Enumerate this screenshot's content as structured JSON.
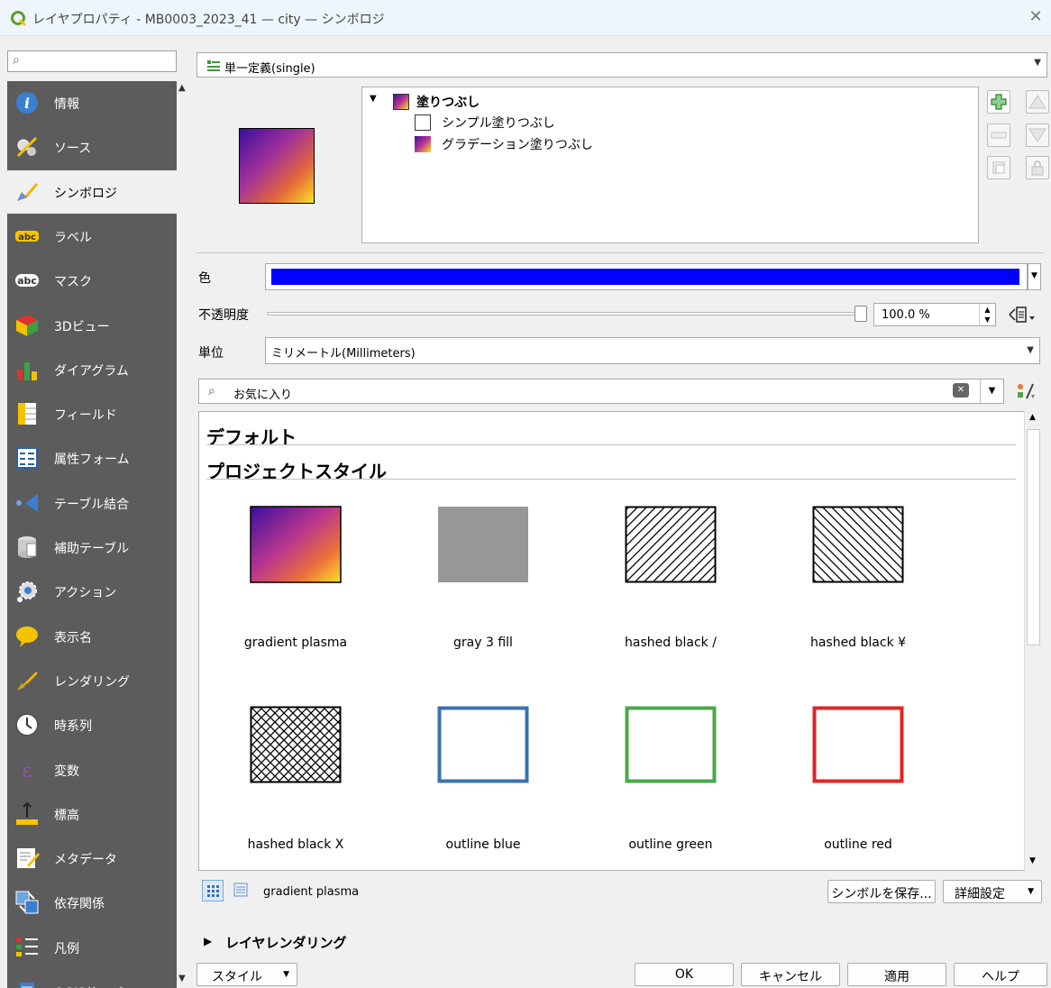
{
  "window": {
    "title": "レイヤプロパティ - MB0003_2023_41 — city — シンボロジ",
    "close_glyph": "✕"
  },
  "sidebar": {
    "search_placeholder": "",
    "items": [
      {
        "label": "情報",
        "icon": "info-icon",
        "selected": false
      },
      {
        "label": "ソース",
        "icon": "source-settings-icon",
        "selected": false
      },
      {
        "label": "シンボロジ",
        "icon": "symbology-brush-icon",
        "selected": true
      },
      {
        "label": "ラベル",
        "icon": "labels-abc-icon",
        "selected": false
      },
      {
        "label": "マスク",
        "icon": "mask-abc-icon",
        "selected": false
      },
      {
        "label": "3Dビュー",
        "icon": "3d-cube-icon",
        "selected": false
      },
      {
        "label": "ダイアグラム",
        "icon": "diagram-icon",
        "selected": false
      },
      {
        "label": "フィールド",
        "icon": "fields-icon",
        "selected": false
      },
      {
        "label": "属性フォーム",
        "icon": "attributes-form-icon",
        "selected": false
      },
      {
        "label": "テーブル結合",
        "icon": "joins-icon",
        "selected": false
      },
      {
        "label": "補助テーブル",
        "icon": "auxiliary-storage-icon",
        "selected": false
      },
      {
        "label": "アクション",
        "icon": "actions-gear-icon",
        "selected": false
      },
      {
        "label": "表示名",
        "icon": "display-speech-icon",
        "selected": false
      },
      {
        "label": "レンダリング",
        "icon": "rendering-brush-icon",
        "selected": false
      },
      {
        "label": "時系列",
        "icon": "temporal-clock-icon",
        "selected": false
      },
      {
        "label": "変数",
        "icon": "variables-epsilon-icon",
        "selected": false
      },
      {
        "label": "標高",
        "icon": "elevation-icon",
        "selected": false
      },
      {
        "label": "メタデータ",
        "icon": "metadata-icon",
        "selected": false
      },
      {
        "label": "依存関係",
        "icon": "dependencies-icon",
        "selected": false
      },
      {
        "label": "凡例",
        "icon": "legend-icon",
        "selected": false
      },
      {
        "label": "QGISサーバ",
        "icon": "qgis-server-icon",
        "selected": false
      }
    ]
  },
  "renderer": {
    "label": "単一定義(single)"
  },
  "symbol_tree": {
    "root": "塗りつぶし",
    "layers": [
      "シンプル塗りつぶし",
      "グラデーション塗りつぶし"
    ]
  },
  "properties": {
    "color_label": "色",
    "color_value": "#0000ff",
    "opacity_label": "不透明度",
    "opacity_value": "100.0 %",
    "unit_label": "単位",
    "unit_value": "ミリメートル(Millimeters)"
  },
  "library": {
    "search_value": "お気に入り",
    "groups": [
      "デフォルト",
      "プロジェクトスタイル"
    ],
    "symbols": [
      {
        "name": "gradient   plasma",
        "style": "gradient"
      },
      {
        "name": "gray 3 fill",
        "style": "gray"
      },
      {
        "name": "hashed black /",
        "style": "hash-slash"
      },
      {
        "name": "hashed black ¥",
        "style": "hash-back"
      },
      {
        "name": "hashed black X",
        "style": "hash-cross"
      },
      {
        "name": "outline blue",
        "style": "outline",
        "color": "#3a73b0"
      },
      {
        "name": "outline green",
        "style": "outline",
        "color": "#4aa84a"
      },
      {
        "name": "outline red",
        "style": "outline",
        "color": "#e02525"
      }
    ],
    "selected_name": "gradient   plasma"
  },
  "buttons": {
    "save_symbol": "シンボルを保存...",
    "advanced": "詳細設定",
    "layer_rendering": "レイヤレンダリング",
    "style": "スタイル",
    "ok": "OK",
    "cancel": "キャンセル",
    "apply": "適用",
    "help": "ヘルプ"
  },
  "colors": {
    "accent_green": "#3c9a3c",
    "sidebar_bg": "#5c5c5c"
  }
}
